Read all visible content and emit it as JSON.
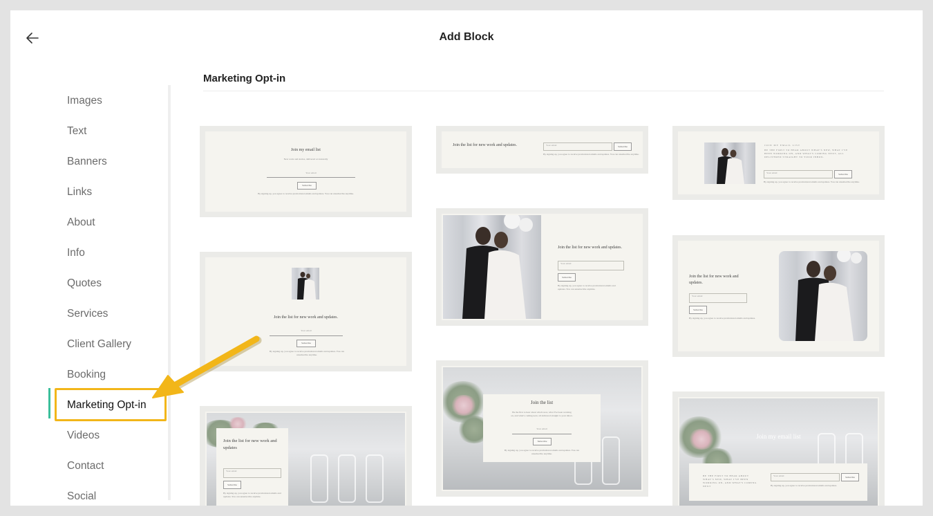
{
  "header": {
    "title": "Add Block"
  },
  "sidebar": {
    "items": [
      {
        "label": "Images"
      },
      {
        "label": "Text"
      },
      {
        "label": "Banners"
      },
      {
        "label": "Links"
      },
      {
        "label": "About"
      },
      {
        "label": "Info"
      },
      {
        "label": "Quotes"
      },
      {
        "label": "Services"
      },
      {
        "label": "Client Gallery"
      },
      {
        "label": "Booking"
      },
      {
        "label": "Marketing Opt-in"
      },
      {
        "label": "Videos"
      },
      {
        "label": "Contact"
      },
      {
        "label": "Social"
      }
    ],
    "active_index": 10
  },
  "section": {
    "title": "Marketing Opt-in"
  },
  "cards": {
    "c1": {
      "heading": "Join my email list",
      "sub": "New work and stories, delivered occasionally",
      "input": "Your email",
      "button": "Subscribe",
      "legal": "By signing up, you agree to receive promotional emails and updates. You can unsubscribe anytime."
    },
    "c2": {
      "heading": "Join the list for new work and updates.",
      "input": "Your email",
      "button": "Subscribe",
      "legal": "By signing up, you agree to receive promotional emails and updates. You can unsubscribe anytime."
    },
    "c3": {
      "kicker": "JOIN MY EMAIL LIST",
      "body": "BE THE FIRST TO HEAR ABOUT WHAT'S NEW, WHAT I'VE BEEN WORKING ON, AND WHAT'S COMING NEXT, ALL DELIVERED STRAIGHT TO YOUR INBOX.",
      "input": "Your email",
      "button": "Subscribe",
      "legal": "By signing up, you agree to receive promotional emails and updates. You can unsubscribe anytime."
    },
    "c4": {
      "heading": "Join the list for new work and updates.",
      "input": "Your email",
      "button": "Subscribe",
      "legal": "By signing up, you agree to receive promotional emails and updates. You can unsubscribe anytime."
    },
    "c5": {
      "heading": "Join the list for new work and updates.",
      "input": "Your email",
      "button": "Subscribe",
      "legal": "By signing up, you agree to receive promotional emails and updates. You can unsubscribe anytime."
    },
    "c6": {
      "heading": "Join the list for new work and updates.",
      "input": "Your email",
      "button": "Subscribe",
      "legal": "By signing up, you agree to receive promotional emails and updates."
    },
    "c7": {
      "heading": "Join the list for new work and updates",
      "input": "Your email",
      "button": "Subscribe",
      "legal": "By signing up, you agree to receive promotional emails and updates. You can unsubscribe anytime."
    },
    "c8": {
      "heading": "Join the list",
      "body": "Be the first to hear about what's new, what I've been working on, and what's coming next, all delivered straight to your inbox.",
      "input": "Your email",
      "button": "Subscribe",
      "legal": "By signing up, you agree to receive promotional emails and updates. You can unsubscribe anytime."
    },
    "c9": {
      "heading": "Join my email list",
      "body": "BE THE FIRST TO HEAR ABOUT WHAT'S NEW, WHAT I'VE BEEN WORKING ON, AND WHAT'S COMING NEXT",
      "input": "Your email",
      "button": "Subscribe",
      "legal": "By signing up, you agree to receive promotional emails and updates."
    }
  },
  "colors": {
    "accent": "#3bbf9b",
    "highlight": "#f2b619",
    "card_bg": "#f5f4ef"
  }
}
